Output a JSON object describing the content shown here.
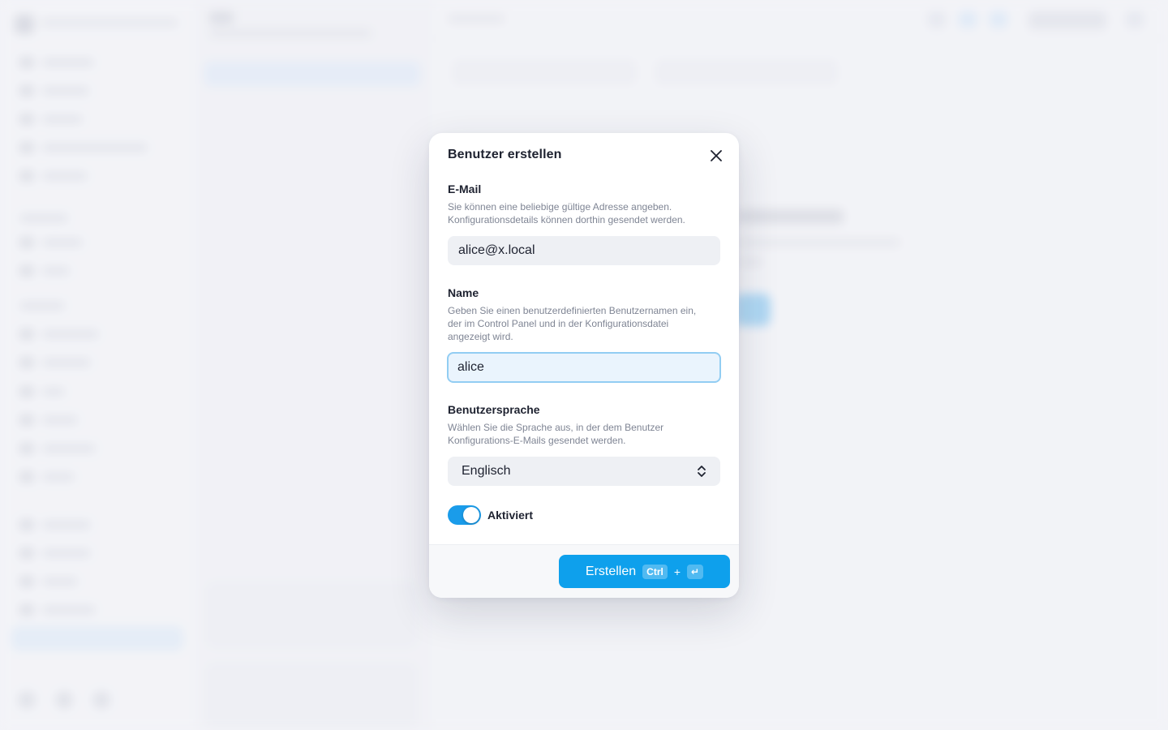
{
  "modal": {
    "title": "Benutzer erstellen",
    "close_icon": "close-icon",
    "email": {
      "label": "E-Mail",
      "help": "Sie können eine beliebige gültige Adresse angeben. Konfigurationsdetails können dorthin gesendet werden.",
      "value": "alice@x.local"
    },
    "name": {
      "label": "Name",
      "help": "Geben Sie einen benutzerdefinierten Benutzernamen ein, der im Control Panel und in der Konfigurationsdatei angezeigt wird.",
      "value": "alice"
    },
    "language": {
      "label": "Benutzersprache",
      "help": "Wählen Sie die Sprache aus, in der dem Benutzer Konfigurations-E-Mails gesendet werden.",
      "selected": "Englisch",
      "icon": "chevron-up-down-icon"
    },
    "active": {
      "label": "Aktiviert",
      "enabled": true
    },
    "footer": {
      "create_label": "Erstellen",
      "shortcut_key": "Ctrl",
      "shortcut_plus": "+",
      "shortcut_enter": "↵"
    }
  },
  "colors": {
    "accent": "#0ea0ec",
    "toggle_on": "#1a9cea",
    "focus_border": "#92cdf3"
  }
}
